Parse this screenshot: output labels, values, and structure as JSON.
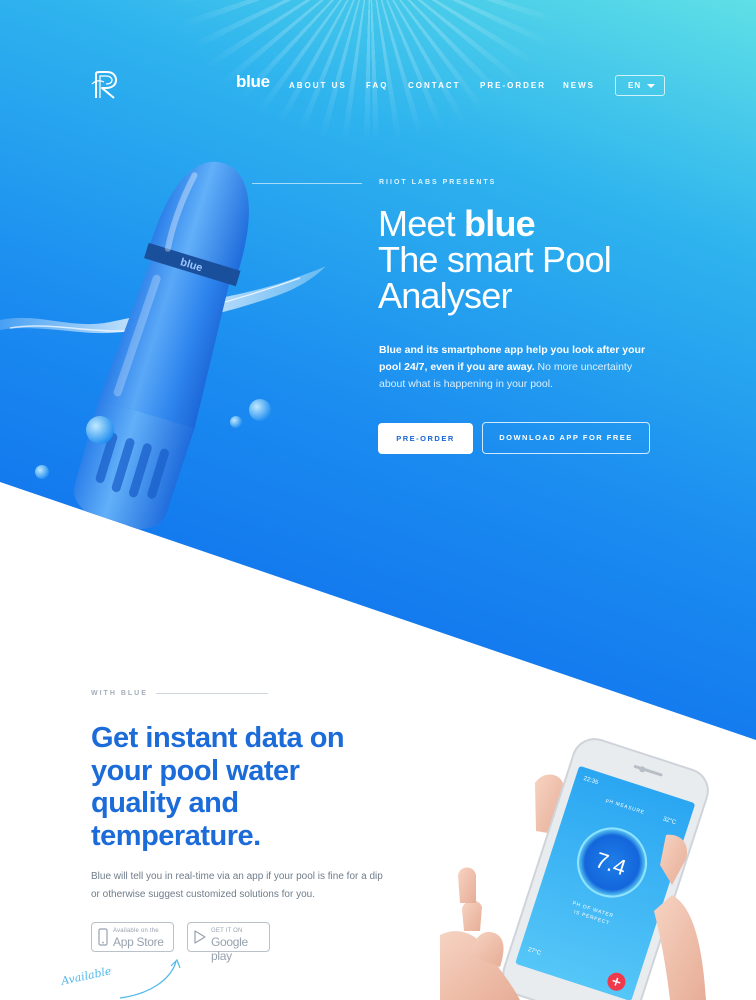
{
  "nav": {
    "brand": "blue",
    "links": [
      "ABOUT US",
      "FAQ",
      "CONTACT",
      "PRE-ORDER",
      "NEWS"
    ],
    "language": "EN"
  },
  "hero": {
    "eyebrow": "RIIOT LABS PRESENTS",
    "title_line1_prefix": "Meet ",
    "title_line1_bold": "blue",
    "title_line2": "The smart Pool",
    "title_line3": "Analyser",
    "desc_bold": "Blue and its smartphone app help you look after your pool 24/7, even if you are away.",
    "desc_rest": " No more uncertainty about what is happening in your pool.",
    "preorder_button": "PRE-ORDER",
    "download_button": "DOWNLOAD APP FOR FREE",
    "device_label": "blue"
  },
  "features": {
    "eyebrow": "WITH BLUE",
    "title_line1": "Get instant data on",
    "title_line2": "your pool water",
    "title_line3": "quality and",
    "title_line4": "temperature.",
    "description": "Blue will tell you in real-time via an app if your pool is fine for a dip or otherwise suggest customized solutions for you.",
    "appstore_small": "Available on the",
    "appstore_big": "App Store",
    "google_small": "GET IT ON",
    "google_big": "Google play",
    "available_note": "Available"
  },
  "phone_screen": {
    "ph_label": "pH MEASURE",
    "ph_value": "7.4",
    "ph_caption_1": "PH OF WATER",
    "ph_caption_2": "IS PERFECT",
    "temp_top": "32°C",
    "temp_bottom": "27°C",
    "time": "22:35"
  },
  "colors": {
    "accent_blue": "#1b6bd9",
    "hero_top": "#5fe0e6",
    "hero_bottom": "#0a63ec",
    "alert_red": "#f0394b"
  }
}
